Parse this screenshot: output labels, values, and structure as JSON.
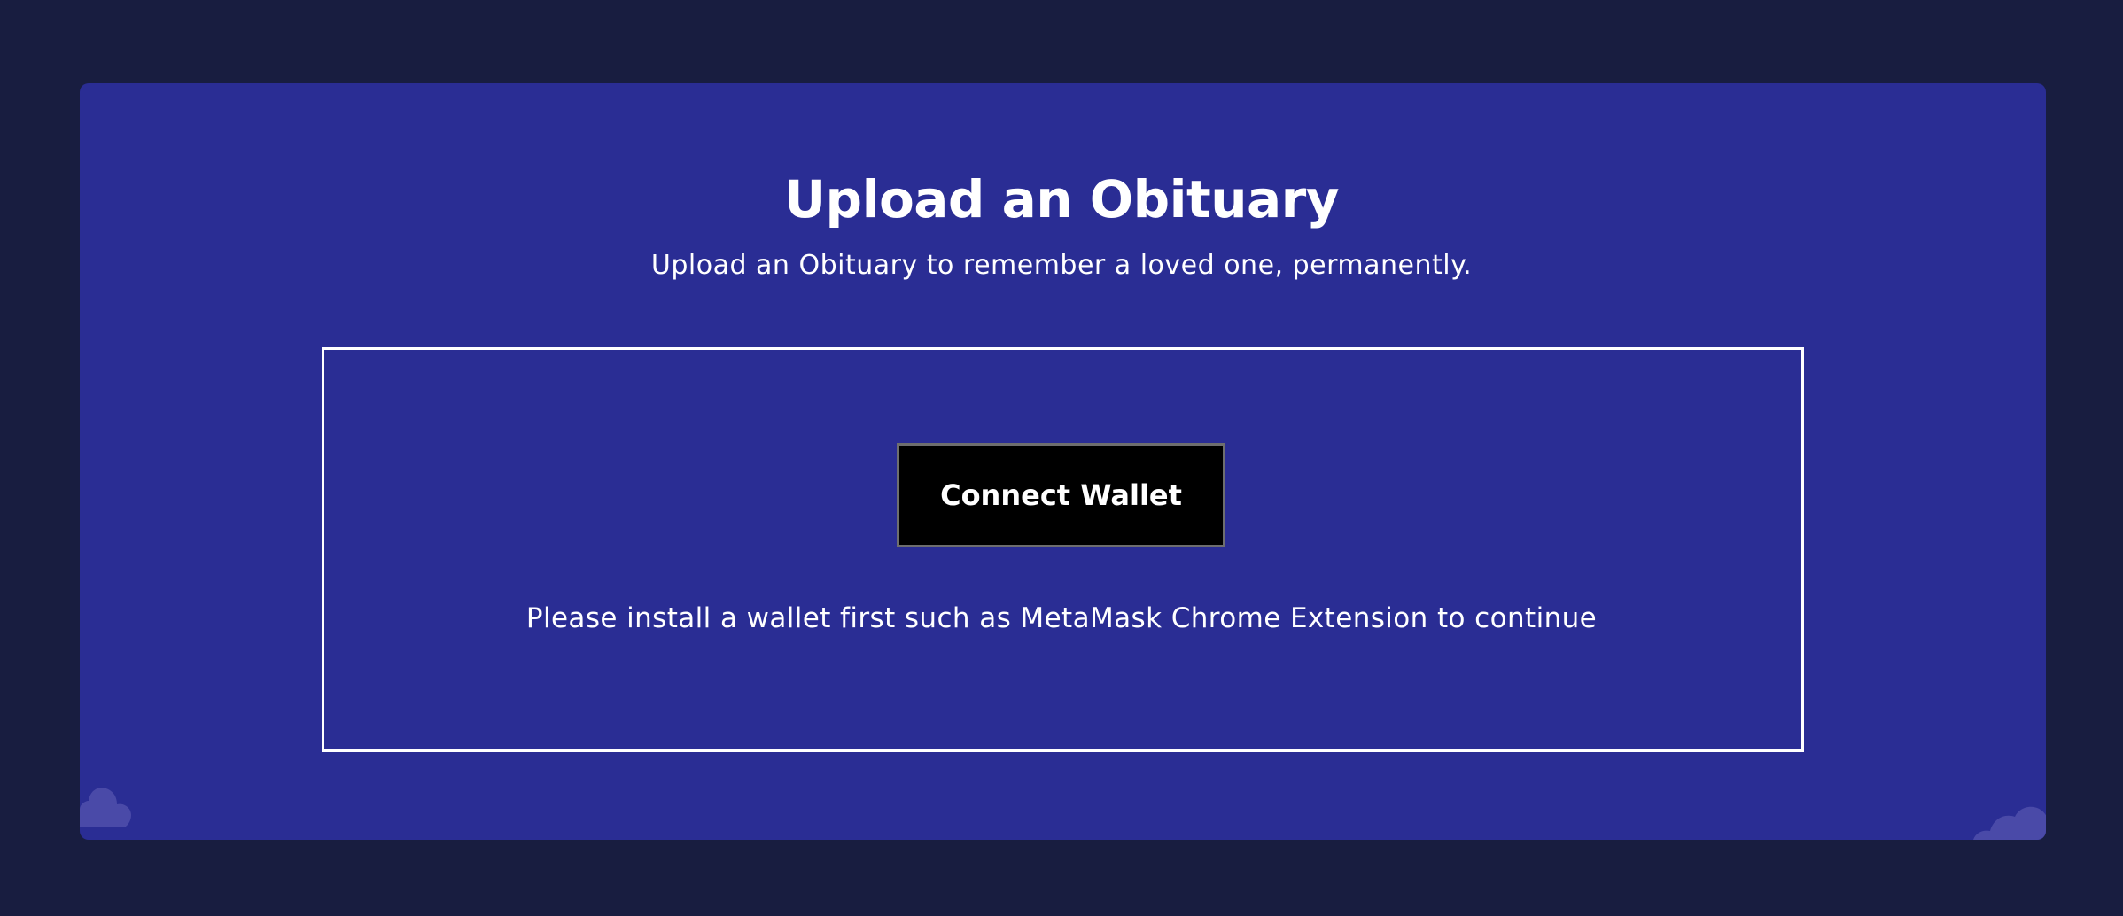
{
  "page": {
    "title": "Upload an Obituary",
    "subtitle": "Upload an Obituary to remember a loved one, permanently."
  },
  "wallet": {
    "connect_label": "Connect Wallet",
    "notice": "Please install a wallet first such as MetaMask Chrome Extension to continue"
  },
  "colors": {
    "page_background": "#181d40",
    "card_background": "#2a2d94",
    "button_background": "#000000",
    "text": "#ffffff",
    "cloud": "#4a4aa8"
  },
  "icons": {
    "left_decoration": "cloud-icon",
    "right_decoration": "cloud-icon"
  }
}
